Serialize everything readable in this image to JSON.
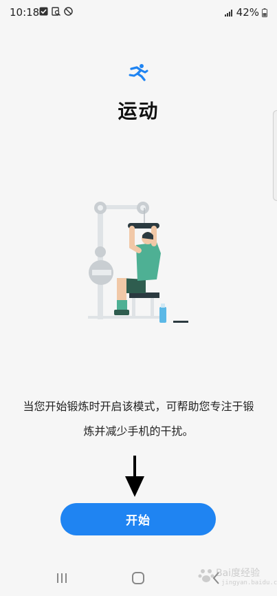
{
  "status_bar": {
    "time": "10:18",
    "battery": "42%",
    "icons": [
      "check-box-icon",
      "notification-search-icon",
      "blocked-icon",
      "signal-icon",
      "battery-icon"
    ]
  },
  "header": {
    "icon": "running-person-icon",
    "title": "运动"
  },
  "illustration": {
    "icon": "workout-illustration"
  },
  "description": "当您开始锻炼时开启该模式，可帮助您专注于锻炼并减少手机的干扰。",
  "start_button": {
    "label": "开始"
  },
  "nav_bar": {
    "icons": [
      "recents-icon",
      "home-icon",
      "back-icon"
    ]
  },
  "watermark": {
    "text": "Bai度经验",
    "sub": "jingyan.baidu.com"
  },
  "colors": {
    "accent": "#1f84f2",
    "background": "#f6f6f6",
    "figure_shirt": "#4eb094",
    "figure_skin": "#f1c8a7",
    "figure_dark": "#2b3a40"
  }
}
